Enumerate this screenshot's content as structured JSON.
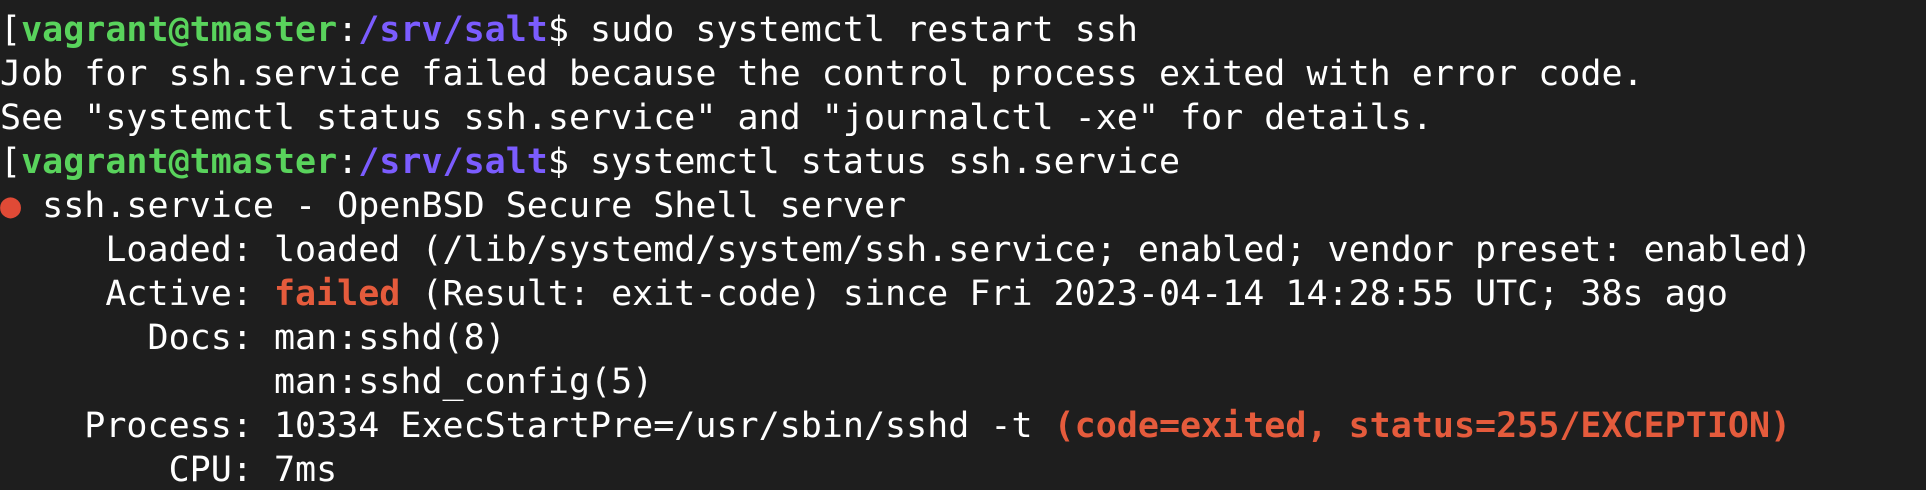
{
  "terminal": {
    "lines": [
      {
        "kind": "prompt",
        "bracket": "[",
        "user_host": "vagrant@tmaster",
        "sep": ":",
        "path": "/srv/salt",
        "dollar": "$",
        "command": " sudo systemctl restart ssh"
      },
      {
        "kind": "output",
        "text": "Job for ssh.service failed because the control process exited with error code."
      },
      {
        "kind": "output",
        "text": "See \"systemctl status ssh.service\" and \"journalctl -xe\" for details."
      },
      {
        "kind": "prompt",
        "bracket": "[",
        "user_host": "vagrant@tmaster",
        "sep": ":",
        "path": "/srv/salt",
        "dollar": "$",
        "command": " systemctl status ssh.service"
      }
    ],
    "status": {
      "dot": "●",
      "title": " ssh.service - OpenBSD Secure Shell server",
      "loaded_label": "     Loaded: ",
      "loaded_value": "loaded (/lib/systemd/system/ssh.service; enabled; vendor preset: enabled)",
      "active_label": "     Active: ",
      "active_state": "failed",
      "active_rest": " (Result: exit-code) since Fri 2023-04-14 14:28:55 UTC; 38s ago",
      "docs_label": "       Docs: ",
      "docs_value_1": "man:sshd(8)",
      "docs_indent": "             ",
      "docs_value_2": "man:sshd_config(5)",
      "process_label": "    Process: ",
      "process_value": "10334 ExecStartPre=/usr/sbin/sshd -t ",
      "process_error": "(code=exited, status=255/EXCEPTION)",
      "cpu_label": "        CPU: ",
      "cpu_value": "7ms"
    },
    "colors": {
      "background": "#1e1e1e",
      "user_host": "#59d35c",
      "path": "#7b5cff",
      "error": "#e55b3c",
      "text": "#ffffff"
    }
  }
}
